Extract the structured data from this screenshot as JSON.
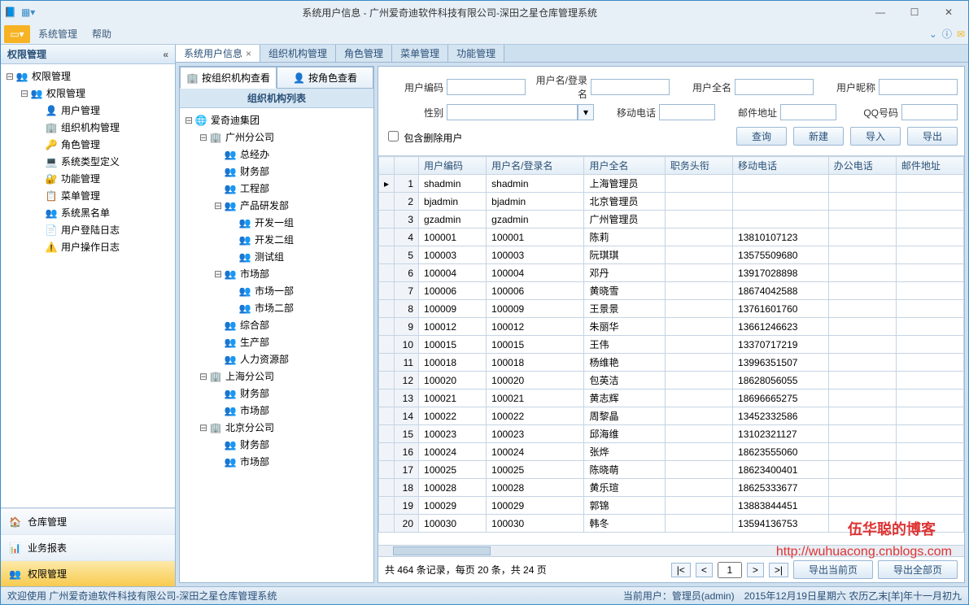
{
  "window": {
    "title": "系统用户信息 - 广州爱奇迪软件科技有限公司-深田之星仓库管理系统"
  },
  "menubar": {
    "items": [
      "系统管理",
      "帮助"
    ]
  },
  "sidebar": {
    "title": "权限管理",
    "root": "权限管理",
    "level2": "权限管理",
    "items": [
      "用户管理",
      "组织机构管理",
      "角色管理",
      "系统类型定义",
      "功能管理",
      "菜单管理",
      "系统黑名单",
      "用户登陆日志",
      "用户操作日志"
    ],
    "bottom": [
      "仓库管理",
      "业务报表",
      "权限管理"
    ]
  },
  "doc_tabs": [
    "系统用户信息",
    "组织机构管理",
    "角色管理",
    "菜单管理",
    "功能管理"
  ],
  "org_panel": {
    "tabs": [
      "按组织机构查看",
      "按角色查看"
    ],
    "header": "组织机构列表",
    "root": "爱奇迪集团",
    "nodes": [
      {
        "name": "广州分公司",
        "children": [
          "总经办",
          "财务部",
          "工程部",
          {
            "name": "产品研发部",
            "children": [
              "开发一组",
              "开发二组",
              "测试组"
            ]
          },
          {
            "name": "市场部",
            "children": [
              "市场一部",
              "市场二部"
            ]
          },
          "综合部",
          "生产部",
          "人力资源部"
        ]
      },
      {
        "name": "上海分公司",
        "children": [
          "财务部",
          "市场部"
        ]
      },
      {
        "name": "北京分公司",
        "children": [
          "财务部",
          "市场部"
        ]
      }
    ]
  },
  "search": {
    "labels": {
      "code": "用户编码",
      "login": "用户名/登录名",
      "fullname": "用户全名",
      "nickname": "用户昵称",
      "gender": "性别",
      "mobile": "移动电话",
      "email": "邮件地址",
      "qq": "QQ号码"
    },
    "checkbox": "包含删除用户",
    "buttons": {
      "query": "查询",
      "new": "新建",
      "import": "导入",
      "export": "导出"
    }
  },
  "grid": {
    "columns": [
      "用户编码",
      "用户名/登录名",
      "用户全名",
      "职务头衔",
      "移动电话",
      "办公电话",
      "邮件地址"
    ],
    "rows": [
      {
        "code": "shadmin",
        "login": "shadmin",
        "name": "上海管理员",
        "mobile": ""
      },
      {
        "code": "bjadmin",
        "login": "bjadmin",
        "name": "北京管理员",
        "mobile": ""
      },
      {
        "code": "gzadmin",
        "login": "gzadmin",
        "name": "广州管理员",
        "mobile": ""
      },
      {
        "code": "100001",
        "login": "100001",
        "name": "陈莉",
        "mobile": "13810107123"
      },
      {
        "code": "100003",
        "login": "100003",
        "name": "阮琪琪",
        "mobile": "13575509680"
      },
      {
        "code": "100004",
        "login": "100004",
        "name": "邓丹",
        "mobile": "13917028898"
      },
      {
        "code": "100006",
        "login": "100006",
        "name": "黄晓雪",
        "mobile": "18674042588"
      },
      {
        "code": "100009",
        "login": "100009",
        "name": "王景景",
        "mobile": "13761601760"
      },
      {
        "code": "100012",
        "login": "100012",
        "name": "朱丽华",
        "mobile": "13661246623"
      },
      {
        "code": "100015",
        "login": "100015",
        "name": "王伟",
        "mobile": "13370717219"
      },
      {
        "code": "100018",
        "login": "100018",
        "name": "杨维艳",
        "mobile": "13996351507"
      },
      {
        "code": "100020",
        "login": "100020",
        "name": "包英洁",
        "mobile": "18628056055"
      },
      {
        "code": "100021",
        "login": "100021",
        "name": "黄志辉",
        "mobile": "18696665275"
      },
      {
        "code": "100022",
        "login": "100022",
        "name": "周黎晶",
        "mobile": "13452332586"
      },
      {
        "code": "100023",
        "login": "100023",
        "name": "邱海维",
        "mobile": "13102321127"
      },
      {
        "code": "100024",
        "login": "100024",
        "name": "张烨",
        "mobile": "18623555060"
      },
      {
        "code": "100025",
        "login": "100025",
        "name": "陈晓萌",
        "mobile": "18623400401"
      },
      {
        "code": "100028",
        "login": "100028",
        "name": "黄乐瑄",
        "mobile": "18625333677"
      },
      {
        "code": "100029",
        "login": "100029",
        "name": "郭锦",
        "mobile": "13883844451"
      },
      {
        "code": "100030",
        "login": "100030",
        "name": "韩冬",
        "mobile": "13594136753"
      }
    ],
    "footer": {
      "summary": "共 464 条记录，每页 20 条，共 24 页",
      "page": "1",
      "export_page": "导出当前页",
      "export_all": "导出全部页"
    }
  },
  "statusbar": {
    "welcome": "欢迎使用 广州爱奇迪软件科技有限公司-深田之星仓库管理系统",
    "user": "当前用户：管理员(admin)",
    "date": "2015年12月19日星期六 农历乙末[羊]年十一月初九"
  },
  "watermark": {
    "line1": "伍华聪的博客",
    "line2": "http://wuhuacong.cnblogs.com"
  }
}
